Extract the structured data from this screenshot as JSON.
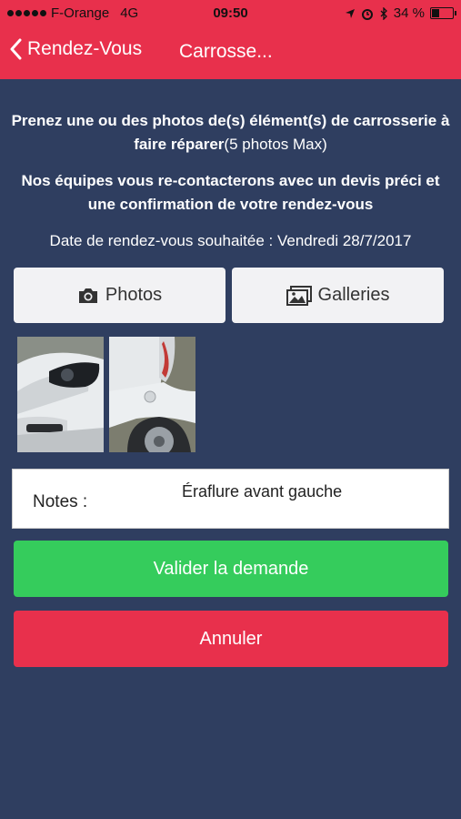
{
  "status_bar": {
    "carrier": "F-Orange",
    "network": "4G",
    "time": "09:50",
    "battery": "34 %",
    "battery_level": 0.34
  },
  "nav": {
    "back_label": "Rendez-Vous",
    "title": "Carrosse..."
  },
  "instructions": {
    "line1_bold": "Prenez une ou des photos de(s) élément(s) de carrosserie à faire réparer",
    "line1_normal": "(5 photos Max)",
    "line2": "Nos équipes vous re-contacterons avec un devis préci et une confirmation de votre rendez-vous"
  },
  "date_label": "Date de rendez-vous souhaitée : Vendredi 28/7/2017",
  "buttons": {
    "photos": "Photos",
    "galleries": "Galleries",
    "validate": "Valider la demande",
    "cancel": "Annuler"
  },
  "notes": {
    "label": "Notes :",
    "value": "Éraflure avant gauche"
  },
  "colors": {
    "accent_red": "#e8304c",
    "background": "#2f3e60",
    "green": "#35cc5c"
  }
}
